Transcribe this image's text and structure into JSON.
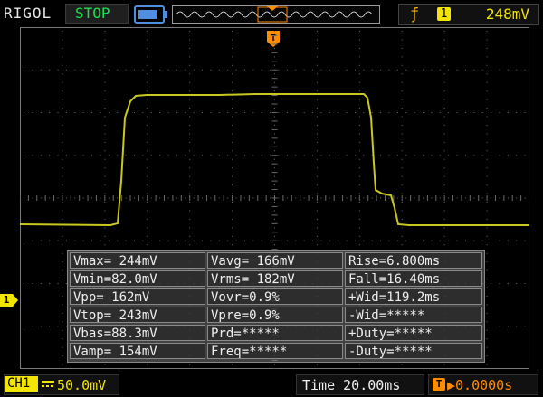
{
  "header": {
    "brand": "RIGOL",
    "run_state": "STOP",
    "trigger": {
      "edge_icon": "rising-edge-icon",
      "source": "1",
      "level": "248mV"
    }
  },
  "channel": {
    "marker": "1",
    "label": "CH1",
    "coupling_icon": "dc-coupling-icon",
    "scale": "50.0mV"
  },
  "timebase": {
    "label": "Time",
    "value": "20.00ms",
    "display": "Time 20.00ms"
  },
  "trigger_offset": {
    "icon": "T",
    "value": "0.0000s"
  },
  "measurements": [
    [
      "Vmax= 244mV",
      "Vavg= 166mV",
      "Rise=6.800ms"
    ],
    [
      "Vmin=82.0mV",
      "Vrms= 182mV",
      "Fall=16.40ms"
    ],
    [
      "Vpp= 162mV",
      "Vovr=0.9%",
      "+Wid=119.2ms"
    ],
    [
      "Vtop= 243mV",
      "Vpre=0.9%",
      "-Wid=*****"
    ],
    [
      "Vbas=88.3mV",
      "Prd=*****",
      "+Duty=*****"
    ],
    [
      "Vamp= 154mV",
      "Freq=*****",
      "-Duty=*****"
    ]
  ],
  "colors": {
    "trace": "#c8c81e",
    "channel": "#f2e500",
    "stop": "#17e04c",
    "trigger": "#ff8c00",
    "grid": "#6a6a6a"
  }
}
